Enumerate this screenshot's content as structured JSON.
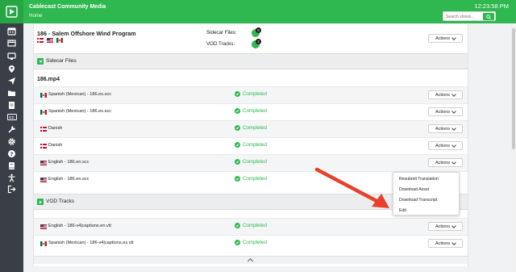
{
  "header": {
    "app_title": "Cablecast Community Media",
    "breadcrumb": "Home",
    "clock": "12:23:58 PM",
    "search_placeholder": "Search shows..."
  },
  "sidebar": {
    "items": [
      {
        "icon": "calendar-icon"
      },
      {
        "icon": "film-icon"
      },
      {
        "icon": "monitor-icon"
      },
      {
        "icon": "location-pin-icon"
      },
      {
        "icon": "send-icon"
      },
      {
        "icon": "folder-icon"
      },
      {
        "icon": "document-icon"
      },
      {
        "icon": "cc-icon",
        "label": "CC"
      },
      {
        "icon": "wrench-icon"
      },
      {
        "icon": "gear-icon"
      },
      {
        "icon": "help-icon"
      },
      {
        "icon": "book-icon"
      },
      {
        "icon": "accessibility-icon"
      },
      {
        "icon": "logout-icon"
      }
    ]
  },
  "program": {
    "title": "186 - Salem Offshore Wind Program",
    "flags": [
      "dk",
      "us",
      "mx"
    ],
    "sidecar_label": "Sidecar Files:",
    "sidecar_count": "6",
    "vod_label": "VOD Tracks:",
    "vod_count": "2",
    "actions_label": "Actions"
  },
  "sidecar_section": {
    "label": "Sidecar Files",
    "file_heading": "186.mp4",
    "rows": [
      {
        "flag": "mx",
        "name": "Spanish (Mexican) - 186.es.scc",
        "status": "Completed",
        "actions": "Actions"
      },
      {
        "flag": "mx",
        "name": "Spanish (Mexican) - 186.es.scc",
        "status": "Completed",
        "actions": "Actions"
      },
      {
        "flag": "dk",
        "name": "Danish",
        "status": "Completed",
        "actions": "Actions"
      },
      {
        "flag": "dk",
        "name": "Danish",
        "status": "Completed",
        "actions": "Actions"
      },
      {
        "flag": "us",
        "name": "English - 186.en.scc",
        "status": "Completed",
        "actions": "Actions"
      },
      {
        "flag": "us",
        "name": "English - 186.en.scc",
        "status": "Completed",
        "actions": "Actions"
      }
    ]
  },
  "actions_menu": {
    "items": [
      "Resubmit Translation",
      "Download Asset",
      "Download Transcript",
      "Edit"
    ]
  },
  "vod_section": {
    "label": "VOD Tracks",
    "rows": [
      {
        "flag": "us",
        "name": "English - 186-v4|captions.en.vtt",
        "status": "Completed",
        "actions": "Actions"
      },
      {
        "flag": "mx",
        "name": "Spanish (Mexican) - 186-v4|captions.es.vtt",
        "status": "Completed",
        "actions": "Actions"
      }
    ]
  },
  "colors": {
    "brand_green": "#2eb84f",
    "sidebar_bg": "#3a3f47",
    "arrow_red": "#e8402a"
  }
}
